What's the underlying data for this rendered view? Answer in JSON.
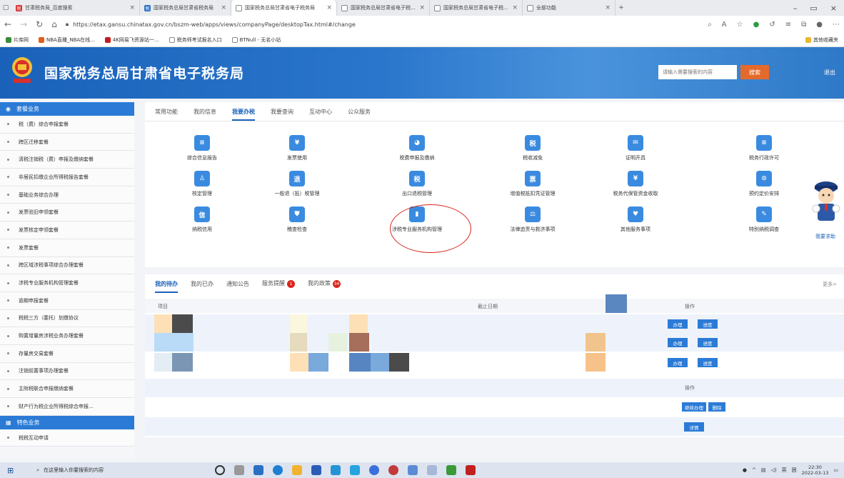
{
  "browser": {
    "tabs": [
      {
        "label": "甘肃税务局_百度搜索",
        "active": false
      },
      {
        "label": "国家税务总局甘肃省税务局",
        "active": false
      },
      {
        "label": "国家税务总局甘肃省电子税务局",
        "active": true
      },
      {
        "label": "国家税务总局甘肃省电子税务局",
        "active": false
      },
      {
        "label": "国家税务总局甘肃省电子税务局",
        "active": false
      },
      {
        "label": "全部功能",
        "active": false
      }
    ],
    "url": "https://etax.gansu.chinatax.gov.cn/bszm-web/apps/views/companyPage/desktopTax.html#/change",
    "bookmarks": [
      "片库网",
      "NBA直播_NBA在线...",
      "4K网易飞资源站一...",
      "税务师考试报名入口",
      "BTNull - 无名小站"
    ],
    "other_bookmarks": "其他收藏夹"
  },
  "header": {
    "title": "国家税务总局甘肃省电子税务局",
    "search_placeholder": "请输入需要搜索的内容",
    "search_label": "搜索",
    "logout_label": "退出"
  },
  "sidebar": {
    "section1": "套餐业务",
    "items": [
      "税（费）综合申报套餐",
      "跨区迁移套餐",
      "清税注销税（费）申报及缴纳套餐",
      "非居民扣缴企业所得税报告套餐",
      "基础业务综合办理",
      "发票验旧申领套餐",
      "发票核定申领套餐",
      "发票套餐",
      "跨区域涉税事项综合办理套餐",
      "涉税专业服务机构管理套餐",
      "逾期申报套餐",
      "税税三方（委托）划缴协议",
      "购置增量房涉税业务办理套餐",
      "存量房交易套餐",
      "注销前置事项办理套餐",
      "主附税联合申报缴纳套餐",
      "财产行为税企业所得税综合申报..."
    ],
    "section2": "特色业务",
    "items2": [
      "税税互动申请"
    ]
  },
  "main": {
    "tabs": [
      "常用功能",
      "我的信息",
      "我要办税",
      "我要查询",
      "互动中心",
      "公众服务"
    ],
    "active_tab": 2,
    "functions": [
      {
        "label": "综合信息报告",
        "icon": "report-icon",
        "color": "#3a8be0"
      },
      {
        "label": "发票使用",
        "icon": "invoice-icon",
        "color": "#3a8be0"
      },
      {
        "label": "税费申报及缴纳",
        "icon": "tax-pay-icon",
        "color": "#3a8be0"
      },
      {
        "label": "税收减免",
        "icon": "tax-relief-icon",
        "color": "#3a8be0"
      },
      {
        "label": "证明开具",
        "icon": "certificate-icon",
        "color": "#3a8be0"
      },
      {
        "label": "税务行政许可",
        "icon": "permit-icon",
        "color": "#3a8be0"
      },
      {
        "label": "核定管理",
        "icon": "assess-icon",
        "color": "#3a8be0"
      },
      {
        "label": "一般退（抵）税管理",
        "icon": "refund-icon",
        "color": "#3a8be0"
      },
      {
        "label": "出口退税管理",
        "icon": "export-refund-icon",
        "color": "#3a8be0"
      },
      {
        "label": "增值税抵扣凭证管理",
        "icon": "vat-voucher-icon",
        "color": "#3a8be0"
      },
      {
        "label": "税务代保管资金收取",
        "icon": "custody-icon",
        "color": "#3a8be0"
      },
      {
        "label": "预约定价安排",
        "icon": "pricing-icon",
        "color": "#3a8be0"
      },
      {
        "label": "纳税信用",
        "icon": "credit-icon",
        "color": "#3a8be0"
      },
      {
        "label": "稽查检查",
        "icon": "inspection-icon",
        "color": "#3a8be0"
      },
      {
        "label": "涉税专业服务机构管理",
        "icon": "agency-icon",
        "color": "#3a8be0"
      },
      {
        "label": "法律追责与救济事项",
        "icon": "legal-icon",
        "color": "#3a8be0"
      },
      {
        "label": "其他服务事项",
        "icon": "heart-icon",
        "color": "#3a8be0"
      },
      {
        "label": "特别纳税调查",
        "icon": "special-audit-icon",
        "color": "#3a8be0"
      }
    ],
    "help_label": "我要求助"
  },
  "tasks": {
    "tabs": [
      "我的待办",
      "我的已办",
      "通知公告",
      "服务提醒",
      "我的政策"
    ],
    "badge_reminder": "1",
    "badge_policy": "34",
    "more_label": "更多>",
    "col_item": "项目",
    "col_deadline": "截止日期",
    "col_action": "操作",
    "handle_label": "办理",
    "progress_label": "进度",
    "action_header2": "操作",
    "continue_label": "继续办理",
    "delete_label": "删除",
    "detail_label": "详情"
  },
  "taskbar": {
    "search_placeholder": "在这里输入你要搜索的内容",
    "ime": "英",
    "time": "22:30",
    "date": "2022-03-13"
  }
}
